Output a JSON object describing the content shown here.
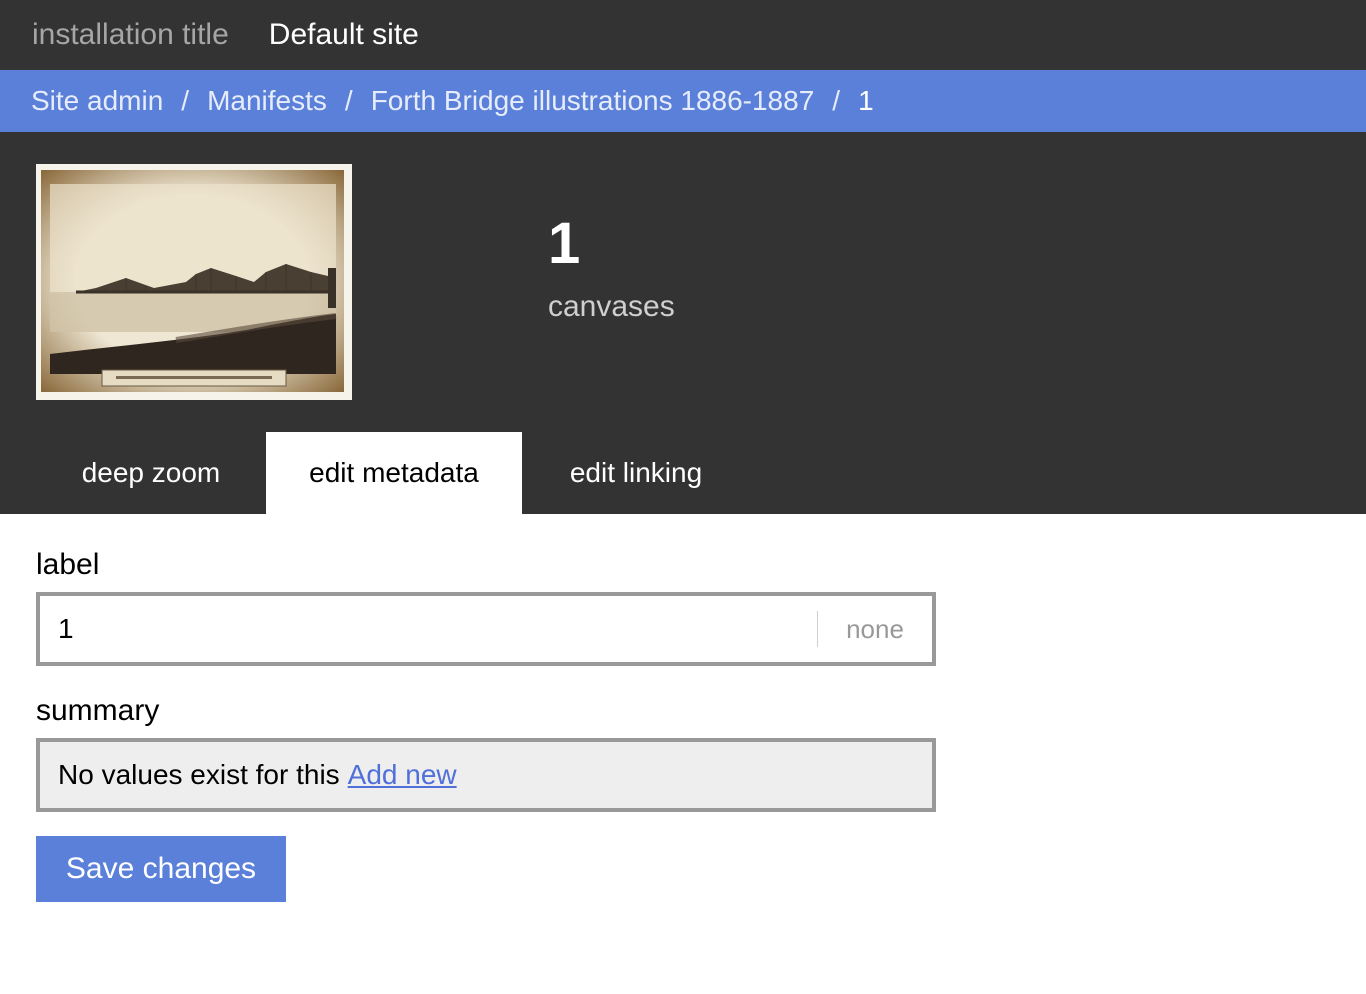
{
  "topbar": {
    "installation_title": "installation title",
    "site_title": "Default site"
  },
  "breadcrumb": {
    "items": [
      "Site admin",
      "Manifests",
      "Forth Bridge illustrations 1886-1887",
      "1"
    ],
    "separator": "/"
  },
  "header": {
    "count": "1",
    "count_label": "canvases"
  },
  "tabs": [
    {
      "label": "deep zoom",
      "active": false
    },
    {
      "label": "edit metadata",
      "active": true
    },
    {
      "label": "edit linking",
      "active": false
    }
  ],
  "form": {
    "label": {
      "title": "label",
      "value": "1",
      "language": "none"
    },
    "summary": {
      "title": "summary",
      "empty_text": "No values exist for this",
      "add_link": "Add new"
    },
    "save_label": "Save changes"
  },
  "colors": {
    "dark": "#333333",
    "accent": "#5b80d9",
    "link": "#4f6fd9"
  },
  "icons": {
    "thumbnail": "forth-bridge-photo"
  }
}
